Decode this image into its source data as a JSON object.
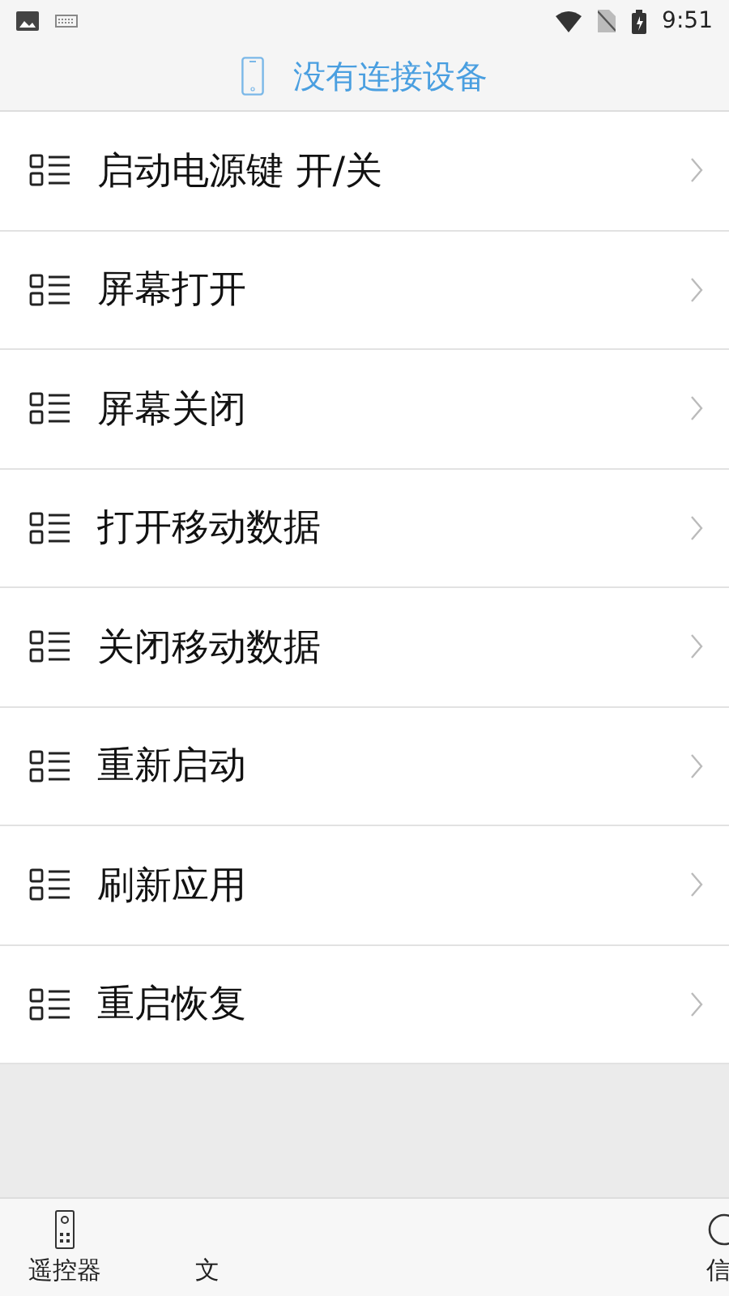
{
  "status_bar": {
    "time": "9:51"
  },
  "header": {
    "title": "没有连接设备"
  },
  "commands": [
    {
      "label": "启动电源键 开/关"
    },
    {
      "label": "屏幕打开"
    },
    {
      "label": "屏幕关闭"
    },
    {
      "label": "打开移动数据"
    },
    {
      "label": "关闭移动数据"
    },
    {
      "label": "重新启动"
    },
    {
      "label": "刷新应用"
    },
    {
      "label": "重启恢复"
    }
  ],
  "tab_bar": [
    {
      "kind": "remote",
      "label": "遥控器"
    },
    {
      "kind": "text",
      "label": "文"
    },
    {
      "kind": "info",
      "label": "信"
    }
  ]
}
